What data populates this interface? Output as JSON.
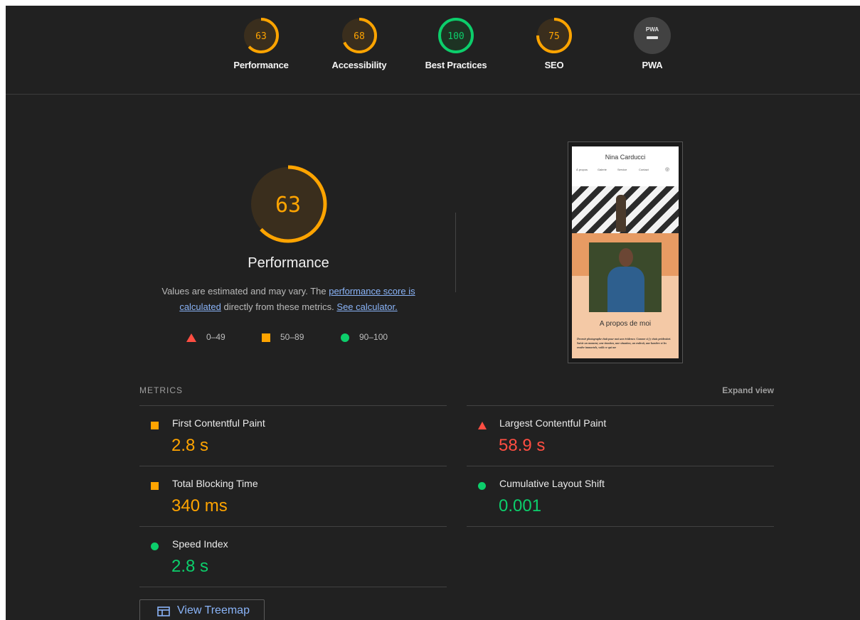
{
  "categories": [
    {
      "label": "Performance",
      "score": "63",
      "value": 0.63,
      "color": "#ffa400",
      "bg": "#3a2e1d"
    },
    {
      "label": "Accessibility",
      "score": "68",
      "value": 0.68,
      "color": "#ffa400",
      "bg": "#3a2e1d"
    },
    {
      "label": "Best Practices",
      "score": "100",
      "value": 1.0,
      "color": "#0cce6b",
      "bg": "#1d3323"
    },
    {
      "label": "SEO",
      "score": "75",
      "value": 0.75,
      "color": "#ffa400",
      "bg": "#3a2e1d"
    },
    {
      "label": "PWA",
      "badge": "PWA",
      "color": "#9e9e9e",
      "bg": "#424242"
    }
  ],
  "performance": {
    "score": "63",
    "value": 0.63,
    "title": "Performance",
    "desc_prefix": "Values are estimated and may vary. The ",
    "desc_link1": "performance score is calculated",
    "desc_middle": " directly from these metrics. ",
    "desc_link2": "See calculator."
  },
  "legend": {
    "fail": "0–49",
    "average": "50–89",
    "pass": "90–100"
  },
  "screenshot": {
    "site_name": "Nina Carducci",
    "nav": [
      "À propos",
      "Galerie",
      "Service",
      "Contact"
    ],
    "section_title": "A propos de moi",
    "body_text": "Devenir photographe était pour moi une évidence. Comme si j'y étais prédestiné. Saisir un moment, une émotion, une situation, un endroit, une lumière et les rendre immortels, voilà ce qui me"
  },
  "metrics": {
    "label": "METRICS",
    "expand_label": "Expand view",
    "items": [
      {
        "name": "First Contentful Paint",
        "value": "2.8 s",
        "status": "average"
      },
      {
        "name": "Largest Contentful Paint",
        "value": "58.9 s",
        "status": "fail"
      },
      {
        "name": "Total Blocking Time",
        "value": "340 ms",
        "status": "average"
      },
      {
        "name": "Cumulative Layout Shift",
        "value": "0.001",
        "status": "pass"
      },
      {
        "name": "Speed Index",
        "value": "2.8 s",
        "status": "pass"
      }
    ]
  },
  "treemap": {
    "label": "View Treemap",
    "icon": "treemap-icon"
  },
  "colors": {
    "background": "#212121",
    "average": "#ffa400",
    "fail": "#ff4e42",
    "pass": "#0cce6b",
    "link": "#8ab4f8"
  }
}
